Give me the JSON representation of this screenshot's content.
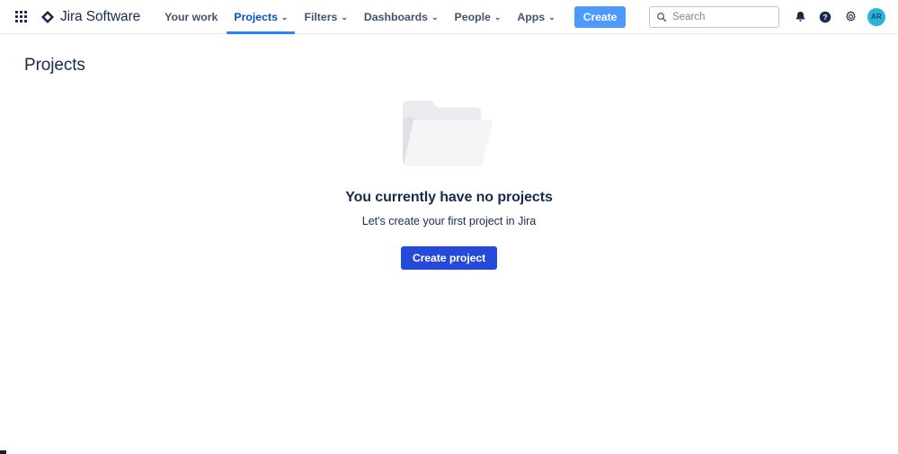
{
  "header": {
    "app_switcher_icon": "grid-apps-icon",
    "logo_icon": "jira-diamond-icon",
    "brand_name": "Jira Software",
    "nav_items": [
      {
        "label": "Your work",
        "has_caret": false,
        "active": false
      },
      {
        "label": "Projects",
        "has_caret": true,
        "active": true
      },
      {
        "label": "Filters",
        "has_caret": true,
        "active": false
      },
      {
        "label": "Dashboards",
        "has_caret": true,
        "active": false
      },
      {
        "label": "People",
        "has_caret": true,
        "active": false
      },
      {
        "label": "Apps",
        "has_caret": true,
        "active": false
      }
    ],
    "create_label": "Create",
    "search": {
      "placeholder": "Search",
      "value": "",
      "icon": "search-icon"
    },
    "icons": [
      {
        "name": "notifications-bell-icon"
      },
      {
        "name": "help-question-icon"
      },
      {
        "name": "settings-gear-icon"
      }
    ],
    "avatar": {
      "initials": "AR"
    },
    "caret_glyph": "⌄"
  },
  "page": {
    "title": "Projects"
  },
  "empty_state": {
    "illustration": "empty-folder-illustration",
    "heading": "You currently have no projects",
    "subtext": "Let's create your first project in Jira",
    "cta_label": "Create project"
  },
  "colors": {
    "brand_blue": "#0052cc",
    "active_tab_underline": "#2684ff",
    "create_button": "#4c9aff",
    "cta_button": "#2549d8",
    "text_primary": "#172b4d",
    "text_subtle": "#42526e",
    "avatar_bg": "#2bb3d4",
    "border": "#ebecf0",
    "folder_back": "#ebecf0",
    "folder_front": "#f4f5f7"
  }
}
